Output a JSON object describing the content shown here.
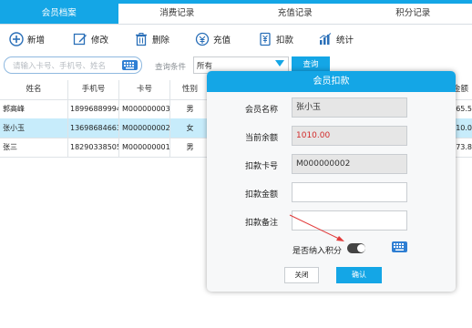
{
  "tabs": [
    {
      "label": "会员档案",
      "active": true
    },
    {
      "label": "消费记录",
      "active": false
    },
    {
      "label": "充值记录",
      "active": false
    },
    {
      "label": "积分记录",
      "active": false
    }
  ],
  "toolbar": {
    "add_label": "新增",
    "edit_label": "修改",
    "delete_label": "删除",
    "recharge_label": "充值",
    "deduct_label": "扣款",
    "stats_label": "统计"
  },
  "search": {
    "placeholder": "请输入卡号、手机号、姓名",
    "condition_label": "查询条件",
    "condition_value": "所有",
    "query_label": "查询"
  },
  "table": {
    "headers": [
      "姓名",
      "手机号",
      "卡号",
      "性别",
      "金额"
    ],
    "rows": [
      {
        "name": "郭高峰",
        "phone": "18996889994",
        "card": "M000000003",
        "gender": "男",
        "amount": "65.5",
        "selected": false
      },
      {
        "name": "张小玉",
        "phone": "13698684663",
        "card": "M000000002",
        "gender": "女",
        "amount": "10.0",
        "selected": true
      },
      {
        "name": "张三",
        "phone": "18290338505",
        "card": "M000000001",
        "gender": "男",
        "amount": "73.8",
        "selected": false
      }
    ]
  },
  "dialog": {
    "title": "会员扣款",
    "fields": {
      "name_label": "会员名称",
      "name_value": "张小玉",
      "balance_label": "当前余额",
      "balance_value": "1010.00",
      "card_label": "扣款卡号",
      "card_value": "M000000002",
      "amount_label": "扣款金额",
      "amount_value": "",
      "remark_label": "扣款备注",
      "remark_value": ""
    },
    "points_label": "是否纳入积分",
    "points_enabled": false,
    "close_label": "关闭",
    "ok_label": "确认"
  },
  "colors": {
    "accent": "#14a6e6",
    "selected_row": "#c7ecfb",
    "balance_text": "#d22b2b",
    "annotation_arrow": "#e23b3b"
  },
  "icons": [
    "plus-circle-icon",
    "edit-icon",
    "trash-icon",
    "recharge-icon",
    "deduct-icon",
    "stats-icon",
    "keyboard-icon",
    "dropdown-arrow-icon"
  ]
}
